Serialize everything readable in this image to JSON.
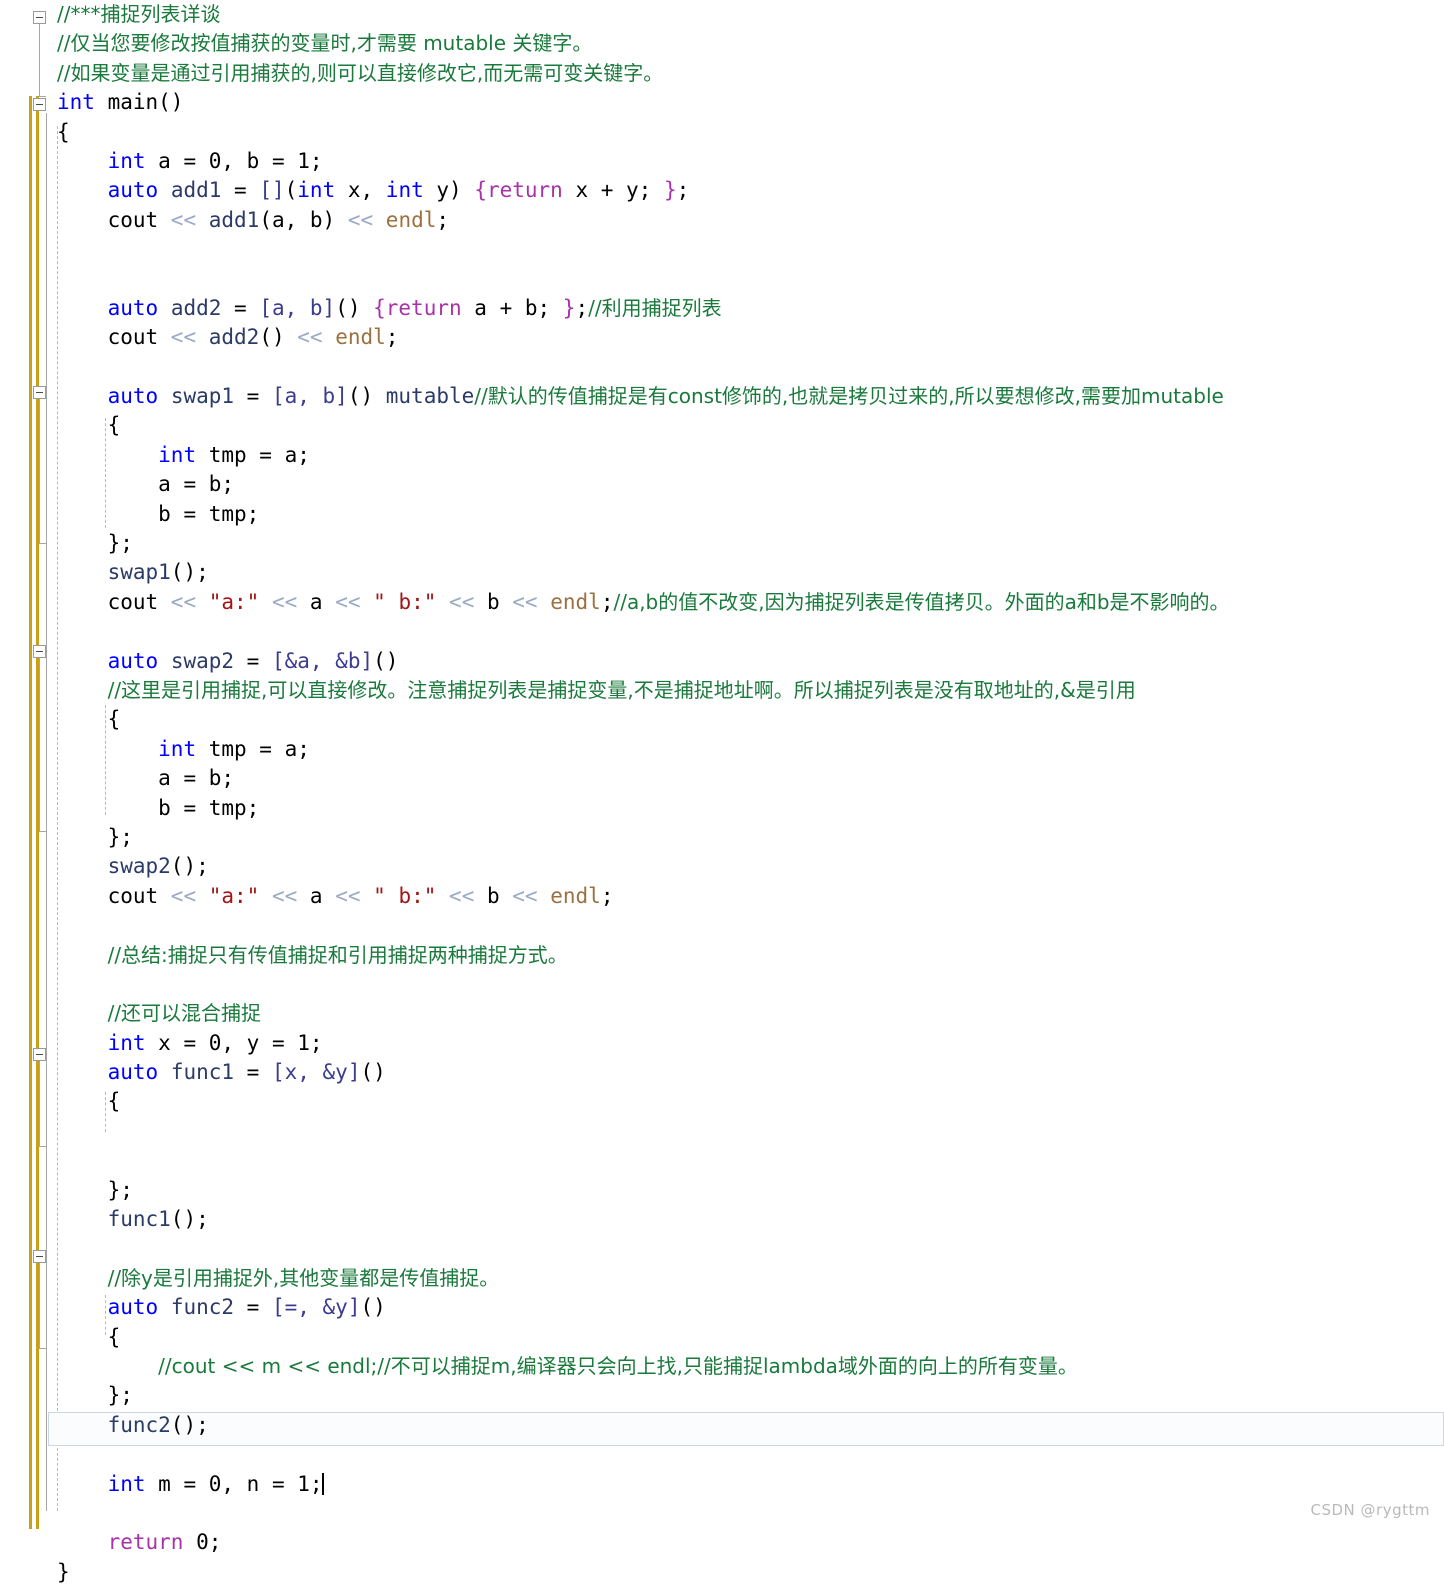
{
  "editor": {
    "language": "cpp",
    "watermark": "CSDN @rygttm",
    "colors": {
      "background": "#ffffff",
      "keyword": "#0000ff",
      "control": "#a832a8",
      "comment": "#1a7a3c",
      "string": "#a31515",
      "operator": "#9aa9c4",
      "identifier": "#2b3a67",
      "stdlib": "#9b7140",
      "change_bar": "#c8a117",
      "current_line_border": "#cdd6e4",
      "indent_guide": "#b8b8b8"
    },
    "current_line": 43,
    "caret_line_text": "    int m = 0, n = 1;"
  },
  "fold_markers": [
    {
      "line": 1,
      "state": "expanded"
    },
    {
      "line": 4,
      "state": "expanded"
    },
    {
      "line": 13,
      "state": "expanded"
    },
    {
      "line": 22,
      "state": "expanded"
    },
    {
      "line": 35,
      "state": "expanded"
    },
    {
      "line": 41,
      "state": "expanded"
    }
  ],
  "lines": [
    {
      "n": 1,
      "indent": 0,
      "tokens": [
        {
          "t": "cmt",
          "v": "//***捕捉列表详谈"
        }
      ]
    },
    {
      "n": 2,
      "indent": 0,
      "tokens": [
        {
          "t": "cmt",
          "v": "//仅当您要修改按值捕获的变量时,才需要 mutable 关键字。"
        }
      ]
    },
    {
      "n": 3,
      "indent": 0,
      "tokens": [
        {
          "t": "cmt",
          "v": "//如果变量是通过引用捕获的,则可以直接修改它,而无需可变关键字。"
        }
      ]
    },
    {
      "n": 4,
      "indent": 0,
      "tokens": [
        {
          "t": "kw",
          "v": "int"
        },
        {
          "t": "pln",
          "v": " main()"
        }
      ]
    },
    {
      "n": 5,
      "indent": 0,
      "tokens": [
        {
          "t": "pln",
          "v": "{"
        }
      ]
    },
    {
      "n": 6,
      "indent": 1,
      "tokens": [
        {
          "t": "kw",
          "v": "int"
        },
        {
          "t": "pln",
          "v": " a = 0, b = 1;"
        }
      ]
    },
    {
      "n": 7,
      "indent": 1,
      "tokens": [
        {
          "t": "kw",
          "v": "auto"
        },
        {
          "t": "pln",
          "v": " "
        },
        {
          "t": "idf",
          "v": "add1"
        },
        {
          "t": "pln",
          "v": " = "
        },
        {
          "t": "brc",
          "v": "[]"
        },
        {
          "t": "pln",
          "v": "("
        },
        {
          "t": "kw",
          "v": "int"
        },
        {
          "t": "pln",
          "v": " x, "
        },
        {
          "t": "kw",
          "v": "int"
        },
        {
          "t": "pln",
          "v": " y) "
        },
        {
          "t": "ctl",
          "v": "{return"
        },
        {
          "t": "pln",
          "v": " x + y; "
        },
        {
          "t": "ctl",
          "v": "}"
        },
        {
          "t": "pln",
          "v": ";"
        }
      ]
    },
    {
      "n": 8,
      "indent": 1,
      "tokens": [
        {
          "t": "pln",
          "v": "cout "
        },
        {
          "t": "op",
          "v": "<<"
        },
        {
          "t": "pln",
          "v": " "
        },
        {
          "t": "idf",
          "v": "add1"
        },
        {
          "t": "pln",
          "v": "(a, b) "
        },
        {
          "t": "op",
          "v": "<<"
        },
        {
          "t": "pln",
          "v": " "
        },
        {
          "t": "std",
          "v": "endl"
        },
        {
          "t": "pln",
          "v": ";"
        }
      ]
    },
    {
      "n": 9,
      "indent": 1,
      "tokens": []
    },
    {
      "n": 10,
      "indent": 1,
      "tokens": []
    },
    {
      "n": 11,
      "indent": 1,
      "tokens": [
        {
          "t": "kw",
          "v": "auto"
        },
        {
          "t": "pln",
          "v": " "
        },
        {
          "t": "idf",
          "v": "add2"
        },
        {
          "t": "pln",
          "v": " = "
        },
        {
          "t": "brc",
          "v": "[a, b]"
        },
        {
          "t": "pln",
          "v": "() "
        },
        {
          "t": "ctl",
          "v": "{return"
        },
        {
          "t": "pln",
          "v": " a + b; "
        },
        {
          "t": "ctl",
          "v": "}"
        },
        {
          "t": "pln",
          "v": ";"
        },
        {
          "t": "cmt",
          "v": "//利用捕捉列表"
        }
      ]
    },
    {
      "n": 12,
      "indent": 1,
      "tokens": [
        {
          "t": "pln",
          "v": "cout "
        },
        {
          "t": "op",
          "v": "<<"
        },
        {
          "t": "pln",
          "v": " "
        },
        {
          "t": "idf",
          "v": "add2"
        },
        {
          "t": "pln",
          "v": "() "
        },
        {
          "t": "op",
          "v": "<<"
        },
        {
          "t": "pln",
          "v": " "
        },
        {
          "t": "std",
          "v": "endl"
        },
        {
          "t": "pln",
          "v": ";"
        }
      ]
    },
    {
      "n": 13,
      "indent": 1,
      "tokens": []
    },
    {
      "n": 14,
      "indent": 1,
      "tokens": [
        {
          "t": "kw",
          "v": "auto"
        },
        {
          "t": "pln",
          "v": " "
        },
        {
          "t": "idf",
          "v": "swap1"
        },
        {
          "t": "pln",
          "v": " = "
        },
        {
          "t": "brc",
          "v": "[a, b]"
        },
        {
          "t": "pln",
          "v": "() "
        },
        {
          "t": "idf",
          "v": "mutable"
        },
        {
          "t": "cmt",
          "v": "//默认的传值捕捉是有const修饰的,也就是拷贝过来的,所以要想修改,需要加mutable"
        }
      ]
    },
    {
      "n": 15,
      "indent": 1,
      "tokens": [
        {
          "t": "pln",
          "v": "{"
        }
      ]
    },
    {
      "n": 16,
      "indent": 2,
      "tokens": [
        {
          "t": "kw",
          "v": "int"
        },
        {
          "t": "pln",
          "v": " tmp = a;"
        }
      ]
    },
    {
      "n": 17,
      "indent": 2,
      "tokens": [
        {
          "t": "pln",
          "v": "a = b;"
        }
      ]
    },
    {
      "n": 18,
      "indent": 2,
      "tokens": [
        {
          "t": "pln",
          "v": "b = tmp;"
        }
      ]
    },
    {
      "n": 19,
      "indent": 1,
      "tokens": [
        {
          "t": "pln",
          "v": "};"
        }
      ]
    },
    {
      "n": 20,
      "indent": 1,
      "tokens": [
        {
          "t": "idf",
          "v": "swap1"
        },
        {
          "t": "pln",
          "v": "();"
        }
      ]
    },
    {
      "n": 21,
      "indent": 1,
      "tokens": [
        {
          "t": "pln",
          "v": "cout "
        },
        {
          "t": "op",
          "v": "<<"
        },
        {
          "t": "pln",
          "v": " "
        },
        {
          "t": "str",
          "v": "\"a:\""
        },
        {
          "t": "pln",
          "v": " "
        },
        {
          "t": "op",
          "v": "<<"
        },
        {
          "t": "pln",
          "v": " a "
        },
        {
          "t": "op",
          "v": "<<"
        },
        {
          "t": "pln",
          "v": " "
        },
        {
          "t": "str",
          "v": "\" b:\""
        },
        {
          "t": "pln",
          "v": " "
        },
        {
          "t": "op",
          "v": "<<"
        },
        {
          "t": "pln",
          "v": " b "
        },
        {
          "t": "op",
          "v": "<<"
        },
        {
          "t": "pln",
          "v": " "
        },
        {
          "t": "std",
          "v": "endl"
        },
        {
          "t": "pln",
          "v": ";"
        },
        {
          "t": "cmt",
          "v": "//a,b的值不改变,因为捕捉列表是传值拷贝。外面的a和b是不影响的。"
        }
      ]
    },
    {
      "n": 22,
      "indent": 1,
      "tokens": []
    },
    {
      "n": 23,
      "indent": 1,
      "tokens": [
        {
          "t": "kw",
          "v": "auto"
        },
        {
          "t": "pln",
          "v": " "
        },
        {
          "t": "idf",
          "v": "swap2"
        },
        {
          "t": "pln",
          "v": " = "
        },
        {
          "t": "brc",
          "v": "[&a, &b]"
        },
        {
          "t": "pln",
          "v": "()"
        }
      ]
    },
    {
      "n": 24,
      "indent": 1,
      "tokens": [
        {
          "t": "cmt",
          "v": "//这里是引用捕捉,可以直接修改。注意捕捉列表是捕捉变量,不是捕捉地址啊。所以捕捉列表是没有取地址的,&是引用"
        }
      ]
    },
    {
      "n": 25,
      "indent": 1,
      "tokens": [
        {
          "t": "pln",
          "v": "{"
        }
      ]
    },
    {
      "n": 26,
      "indent": 2,
      "tokens": [
        {
          "t": "kw",
          "v": "int"
        },
        {
          "t": "pln",
          "v": " tmp = a;"
        }
      ]
    },
    {
      "n": 27,
      "indent": 2,
      "tokens": [
        {
          "t": "pln",
          "v": "a = b;"
        }
      ]
    },
    {
      "n": 28,
      "indent": 2,
      "tokens": [
        {
          "t": "pln",
          "v": "b = tmp;"
        }
      ]
    },
    {
      "n": 29,
      "indent": 1,
      "tokens": [
        {
          "t": "pln",
          "v": "};"
        }
      ]
    },
    {
      "n": 30,
      "indent": 1,
      "tokens": [
        {
          "t": "idf",
          "v": "swap2"
        },
        {
          "t": "pln",
          "v": "();"
        }
      ]
    },
    {
      "n": 31,
      "indent": 1,
      "tokens": [
        {
          "t": "pln",
          "v": "cout "
        },
        {
          "t": "op",
          "v": "<<"
        },
        {
          "t": "pln",
          "v": " "
        },
        {
          "t": "str",
          "v": "\"a:\""
        },
        {
          "t": "pln",
          "v": " "
        },
        {
          "t": "op",
          "v": "<<"
        },
        {
          "t": "pln",
          "v": " a "
        },
        {
          "t": "op",
          "v": "<<"
        },
        {
          "t": "pln",
          "v": " "
        },
        {
          "t": "str",
          "v": "\" b:\""
        },
        {
          "t": "pln",
          "v": " "
        },
        {
          "t": "op",
          "v": "<<"
        },
        {
          "t": "pln",
          "v": " b "
        },
        {
          "t": "op",
          "v": "<<"
        },
        {
          "t": "pln",
          "v": " "
        },
        {
          "t": "std",
          "v": "endl"
        },
        {
          "t": "pln",
          "v": ";"
        }
      ]
    },
    {
      "n": 32,
      "indent": 1,
      "tokens": []
    },
    {
      "n": 33,
      "indent": 1,
      "tokens": [
        {
          "t": "cmt",
          "v": "//总结:捕捉只有传值捕捉和引用捕捉两种捕捉方式。"
        }
      ]
    },
    {
      "n": 34,
      "indent": 1,
      "tokens": []
    },
    {
      "n": 35,
      "indent": 1,
      "tokens": [
        {
          "t": "cmt",
          "v": "//还可以混合捕捉"
        }
      ]
    },
    {
      "n": 36,
      "indent": 1,
      "tokens": [
        {
          "t": "kw",
          "v": "int"
        },
        {
          "t": "pln",
          "v": " x = 0, y = 1;"
        }
      ]
    },
    {
      "n": 37,
      "indent": 1,
      "tokens": [
        {
          "t": "kw",
          "v": "auto"
        },
        {
          "t": "pln",
          "v": " "
        },
        {
          "t": "idf",
          "v": "func1"
        },
        {
          "t": "pln",
          "v": " = "
        },
        {
          "t": "brc",
          "v": "[x, &y]"
        },
        {
          "t": "pln",
          "v": "()"
        }
      ]
    },
    {
      "n": 38,
      "indent": 1,
      "tokens": [
        {
          "t": "pln",
          "v": "{"
        }
      ]
    },
    {
      "n": 39,
      "indent": 2,
      "tokens": []
    },
    {
      "n": 40,
      "indent": 2,
      "tokens": []
    },
    {
      "n": 41,
      "indent": 1,
      "tokens": [
        {
          "t": "pln",
          "v": "};"
        }
      ]
    },
    {
      "n": 42,
      "indent": 1,
      "tokens": [
        {
          "t": "idf",
          "v": "func1"
        },
        {
          "t": "pln",
          "v": "();"
        }
      ]
    },
    {
      "n": 43,
      "indent": 1,
      "tokens": []
    },
    {
      "n": 44,
      "indent": 1,
      "tokens": [
        {
          "t": "cmt",
          "v": "//除y是引用捕捉外,其他变量都是传值捕捉。"
        }
      ]
    },
    {
      "n": 45,
      "indent": 1,
      "tokens": [
        {
          "t": "kw",
          "v": "auto"
        },
        {
          "t": "pln",
          "v": " "
        },
        {
          "t": "idf",
          "v": "func2"
        },
        {
          "t": "pln",
          "v": " = "
        },
        {
          "t": "brc",
          "v": "[=, &y]"
        },
        {
          "t": "pln",
          "v": "()"
        }
      ]
    },
    {
      "n": 46,
      "indent": 1,
      "tokens": [
        {
          "t": "pln",
          "v": "{"
        }
      ]
    },
    {
      "n": 47,
      "indent": 2,
      "tokens": [
        {
          "t": "cmt",
          "v": "//cout << m << endl;//不可以捕捉m,编译器只会向上找,只能捕捉lambda域外面的向上的所有变量。"
        }
      ]
    },
    {
      "n": 48,
      "indent": 1,
      "tokens": [
        {
          "t": "pln",
          "v": "};"
        }
      ]
    },
    {
      "n": 49,
      "indent": 1,
      "tokens": [
        {
          "t": "idf",
          "v": "func2"
        },
        {
          "t": "pln",
          "v": "();"
        }
      ]
    },
    {
      "n": 50,
      "indent": 1,
      "tokens": []
    },
    {
      "n": 51,
      "indent": 1,
      "tokens": [
        {
          "t": "kw",
          "v": "int"
        },
        {
          "t": "pln",
          "v": " m = 0, n = 1;"
        }
      ],
      "current": true
    },
    {
      "n": 52,
      "indent": 1,
      "tokens": []
    },
    {
      "n": 53,
      "indent": 1,
      "tokens": [
        {
          "t": "ctl",
          "v": "return"
        },
        {
          "t": "pln",
          "v": " 0;"
        }
      ]
    },
    {
      "n": 54,
      "indent": 0,
      "tokens": [
        {
          "t": "pln",
          "v": "}"
        }
      ]
    }
  ]
}
